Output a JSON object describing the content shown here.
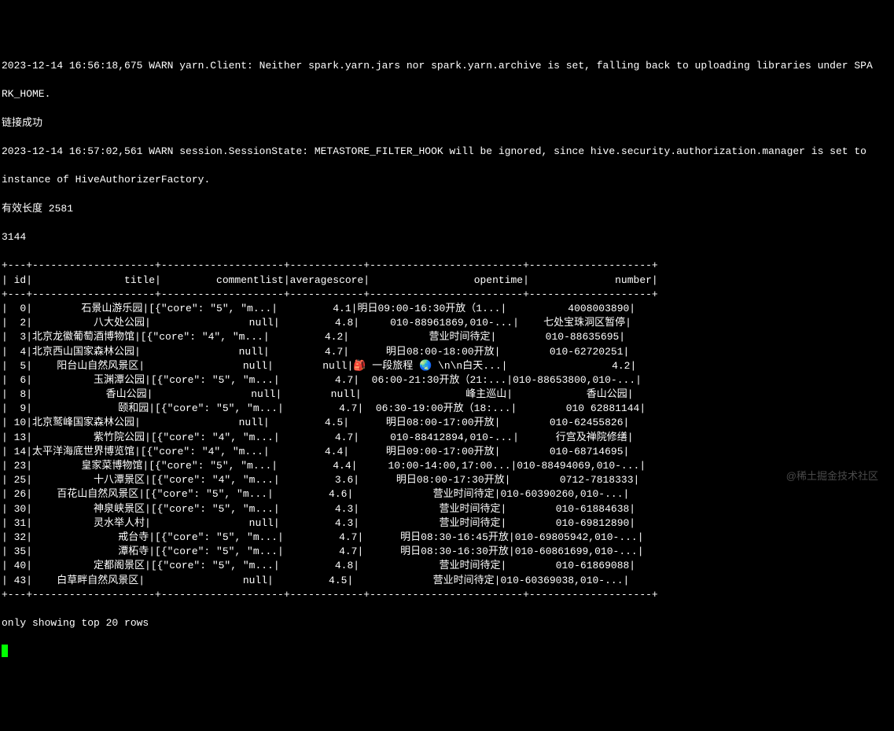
{
  "log": {
    "line1": "2023-12-14 16:56:18,675 WARN yarn.Client: Neither spark.yarn.jars nor spark.yarn.archive is set, falling back to uploading libraries under SPA",
    "line2": "RK_HOME.",
    "line3": "链接成功",
    "line4": "2023-12-14 16:57:02,561 WARN session.SessionState: METASTORE_FILTER_HOOK will be ignored, since hive.security.authorization.manager is set to",
    "line5": "instance of HiveAuthorizerFactory.",
    "line6": "有效长度 2581",
    "line7": "3144"
  },
  "table": {
    "headers": {
      "id": "id",
      "title": "title",
      "commentlist": "commentlist",
      "averagescore": "averagescore",
      "opentime": "opentime",
      "number": "number"
    },
    "rows": [
      {
        "id": "0",
        "title": "石景山游乐园",
        "commentlist": "[{\"core\": \"5\", \"m...",
        "avg": "4.1",
        "opentime": "明日09:00-16:30开放（1...",
        "number": "4008003890"
      },
      {
        "id": "2",
        "title": "八大处公园",
        "commentlist": "null",
        "avg": "4.8",
        "opentime": "010-88961869,010-...",
        "number": "七处宝珠洞区暂停"
      },
      {
        "id": "3",
        "title": "北京龙徽葡萄酒博物馆",
        "commentlist": "[{\"core\": \"4\", \"m...",
        "avg": "4.2",
        "opentime": "营业时间待定",
        "number": "010-88635695"
      },
      {
        "id": "4",
        "title": "北京西山国家森林公园",
        "commentlist": "null",
        "avg": "4.7",
        "opentime": "明日08:00-18:00开放",
        "number": "010-62720251"
      },
      {
        "id": "5",
        "title": "阳台山自然风景区",
        "commentlist": "null",
        "avg": "null",
        "opentime": "🎒 一段旅程 🌏 \\n\\n白天...",
        "number": "4.2"
      },
      {
        "id": "6",
        "title": "玉渊潭公园",
        "commentlist": "[{\"core\": \"5\", \"m...",
        "avg": "4.7",
        "opentime": "06:00-21:30开放（21:...",
        "number": "010-88653800,010-..."
      },
      {
        "id": "8",
        "title": "香山公园",
        "commentlist": "null",
        "avg": "null",
        "opentime": "峰主巡山",
        "number": "香山公园"
      },
      {
        "id": "9",
        "title": "颐和园",
        "commentlist": "[{\"core\": \"5\", \"m...",
        "avg": "4.7",
        "opentime": "06:30-19:00开放（18:...",
        "number": "010 62881144"
      },
      {
        "id": "10",
        "title": "北京鹫峰国家森林公园",
        "commentlist": "null",
        "avg": "4.5",
        "opentime": "明日08:00-17:00开放",
        "number": "010-62455826"
      },
      {
        "id": "13",
        "title": "紫竹院公园",
        "commentlist": "[{\"core\": \"4\", \"m...",
        "avg": "4.7",
        "opentime": "010-88412894,010-...",
        "number": "行宫及禅院修缮"
      },
      {
        "id": "14",
        "title": "太平洋海底世界博览馆",
        "commentlist": "[{\"core\": \"4\", \"m...",
        "avg": "4.4",
        "opentime": "明日09:00-17:00开放",
        "number": "010-68714695"
      },
      {
        "id": "23",
        "title": "皇家菜博物馆",
        "commentlist": "[{\"core\": \"5\", \"m...",
        "avg": "4.4",
        "opentime": "10:00-14:00,17:00...",
        "number": "010-88494069,010-..."
      },
      {
        "id": "25",
        "title": "十八潭景区",
        "commentlist": "[{\"core\": \"4\", \"m...",
        "avg": "3.6",
        "opentime": "明日08:00-17:30开放",
        "number": "0712-7818333"
      },
      {
        "id": "26",
        "title": "百花山自然风景区",
        "commentlist": "[{\"core\": \"5\", \"m...",
        "avg": "4.6",
        "opentime": "营业时间待定",
        "number": "010-60390260,010-..."
      },
      {
        "id": "30",
        "title": "神泉峡景区",
        "commentlist": "[{\"core\": \"5\", \"m...",
        "avg": "4.3",
        "opentime": "营业时间待定",
        "number": "010-61884638"
      },
      {
        "id": "31",
        "title": "灵水举人村",
        "commentlist": "null",
        "avg": "4.3",
        "opentime": "营业时间待定",
        "number": "010-69812890"
      },
      {
        "id": "32",
        "title": "戒台寺",
        "commentlist": "[{\"core\": \"5\", \"m...",
        "avg": "4.7",
        "opentime": "明日08:30-16:45开放",
        "number": "010-69805942,010-..."
      },
      {
        "id": "35",
        "title": "潭柘寺",
        "commentlist": "[{\"core\": \"5\", \"m...",
        "avg": "4.7",
        "opentime": "明日08:30-16:30开放",
        "number": "010-60861699,010-..."
      },
      {
        "id": "40",
        "title": "定都阁景区",
        "commentlist": "[{\"core\": \"5\", \"m...",
        "avg": "4.8",
        "opentime": "营业时间待定",
        "number": "010-61869088"
      },
      {
        "id": "43",
        "title": "白草畔自然风景区",
        "commentlist": "null",
        "avg": "4.5",
        "opentime": "营业时间待定",
        "number": "010-60369038,010-..."
      }
    ]
  },
  "footer": "only showing top 20 rows",
  "watermark": "@稀土掘金技术社区"
}
